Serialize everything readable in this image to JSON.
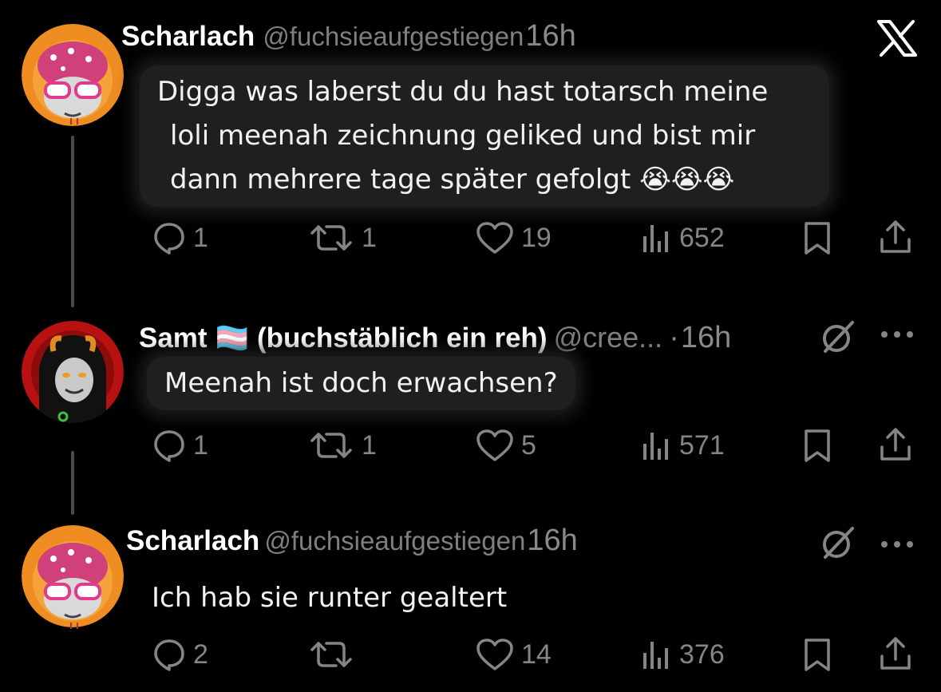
{
  "brand": {
    "logo": "X"
  },
  "tweets": [
    {
      "name": "Scharlach",
      "handle": "@fuchsieaufgestiegen",
      "time": "16h",
      "text_lines": [
        "Digga was laberst du du hast totarsch meine",
        "loli meenah zeichnung geliked und bist mir",
        "dann  mehrere tage später gefolgt 😭😭😭"
      ],
      "replies": "1",
      "reposts": "1",
      "likes": "19",
      "views": "652"
    },
    {
      "name": "Samt",
      "flag": "🏳️‍⚧️",
      "name_suffix": "(buchstäblich ein reh)",
      "handle": "@cree...",
      "separator": "·",
      "time": "16h",
      "text": "Meenah ist doch erwachsen?",
      "replies": "1",
      "reposts": "1",
      "likes": "5",
      "views": "571"
    },
    {
      "name": "Scharlach",
      "handle": "@fuchsieaufgestiegen",
      "time": "16h",
      "text": "Ich hab sie runter gealtert",
      "replies": "2",
      "reposts": "",
      "likes": "14",
      "views": "376"
    }
  ],
  "colors": {
    "background": "#000000",
    "icon_gray": "#858585",
    "thread_line": "#4a4a4a"
  }
}
